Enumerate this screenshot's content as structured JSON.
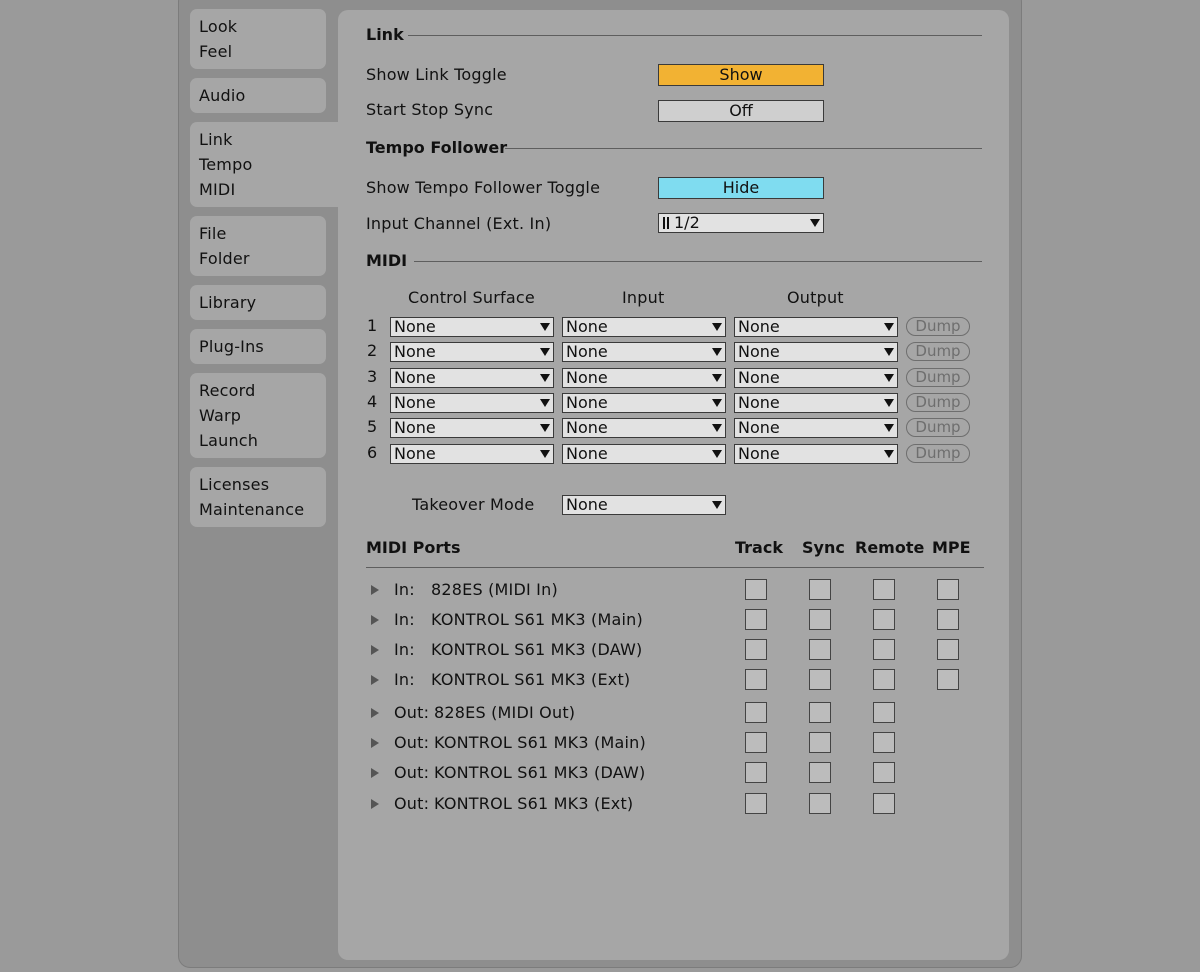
{
  "sidebar": {
    "tabs": [
      [
        "Look",
        "Feel"
      ],
      [
        "Audio"
      ],
      [
        "Link",
        "Tempo",
        "MIDI"
      ],
      [
        "File",
        "Folder"
      ],
      [
        "Library"
      ],
      [
        "Plug-Ins"
      ],
      [
        "Record",
        "Warp",
        "Launch"
      ],
      [
        "Licenses",
        "Maintenance"
      ]
    ]
  },
  "link": {
    "section": "Link",
    "show_toggle_label": "Show Link Toggle",
    "show_toggle_value": "Show",
    "start_stop_label": "Start Stop Sync",
    "start_stop_value": "Off"
  },
  "tempo": {
    "section": "Tempo Follower",
    "show_toggle_label": "Show Tempo Follower Toggle",
    "show_toggle_value": "Hide",
    "input_channel_label": "Input Channel (Ext. In)",
    "input_channel_value": "1/2"
  },
  "midi": {
    "section": "MIDI",
    "col_control_surface": "Control Surface",
    "col_input": "Input",
    "col_output": "Output",
    "rows": [
      {
        "num": "1",
        "cs": "None",
        "in": "None",
        "out": "None",
        "dump": "Dump"
      },
      {
        "num": "2",
        "cs": "None",
        "in": "None",
        "out": "None",
        "dump": "Dump"
      },
      {
        "num": "3",
        "cs": "None",
        "in": "None",
        "out": "None",
        "dump": "Dump"
      },
      {
        "num": "4",
        "cs": "None",
        "in": "None",
        "out": "None",
        "dump": "Dump"
      },
      {
        "num": "5",
        "cs": "None",
        "in": "None",
        "out": "None",
        "dump": "Dump"
      },
      {
        "num": "6",
        "cs": "None",
        "in": "None",
        "out": "None",
        "dump": "Dump"
      }
    ],
    "takeover_label": "Takeover Mode",
    "takeover_value": "None"
  },
  "ports": {
    "header": "MIDI Ports",
    "col_track": "Track",
    "col_sync": "Sync",
    "col_remote": "Remote",
    "col_mpe": "MPE",
    "items": [
      {
        "dir": "In:",
        "name": "828ES (MIDI In)",
        "mpe": true
      },
      {
        "dir": "In:",
        "name": "KONTROL S61 MK3 (Main)",
        "mpe": true
      },
      {
        "dir": "In:",
        "name": "KONTROL S61 MK3 (DAW)",
        "mpe": true
      },
      {
        "dir": "In:",
        "name": "KONTROL S61 MK3 (Ext)",
        "mpe": true
      },
      {
        "dir": "Out:",
        "name": "828ES (MIDI Out)",
        "mpe": false
      },
      {
        "dir": "Out:",
        "name": "KONTROL S61 MK3 (Main)",
        "mpe": false
      },
      {
        "dir": "Out:",
        "name": "KONTROL S61 MK3 (DAW)",
        "mpe": false
      },
      {
        "dir": "Out:",
        "name": "KONTROL S61 MK3 (Ext)",
        "mpe": false
      }
    ]
  },
  "colors": {
    "show_button": "#f2b233",
    "hide_button": "#7fdcf0",
    "off_button": "#cfcfcf"
  }
}
